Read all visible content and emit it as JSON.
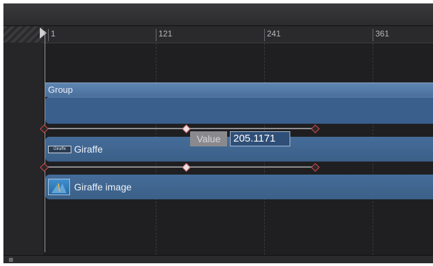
{
  "ruler": {
    "labels": [
      "1",
      "121",
      "241",
      "361"
    ]
  },
  "group": {
    "label": "Group"
  },
  "layers": {
    "giraffe": {
      "label": "Giraffe",
      "badge_text": "Giraffe"
    },
    "giraffe_image": {
      "label": "Giraffe image"
    }
  },
  "value_editor": {
    "label": "Value",
    "value": "205.1171"
  },
  "colors": {
    "layer_blue": "#456c99",
    "keyframe_red": "#d94a4a"
  }
}
